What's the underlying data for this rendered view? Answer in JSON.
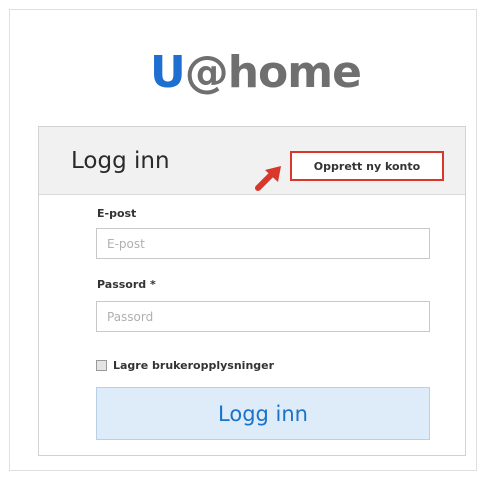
{
  "logo": {
    "u": "U",
    "rest": "@home"
  },
  "login_panel": {
    "title": "Logg inn",
    "create_account": "Opprett ny konto",
    "email": {
      "label": "E-post",
      "placeholder": "E-post",
      "value": ""
    },
    "password": {
      "label": "Passord *",
      "placeholder": "Passord",
      "value": ""
    },
    "remember": {
      "label": "Lagre brukeropplysninger",
      "checked": false
    },
    "submit": "Logg inn"
  },
  "colors": {
    "brand_blue": "#1f6fd0",
    "brand_gray": "#6f6f6f",
    "highlight_red": "#d8372b",
    "button_bg": "#deebf8"
  },
  "icons": {
    "callout": "arrow-up-right-icon"
  }
}
